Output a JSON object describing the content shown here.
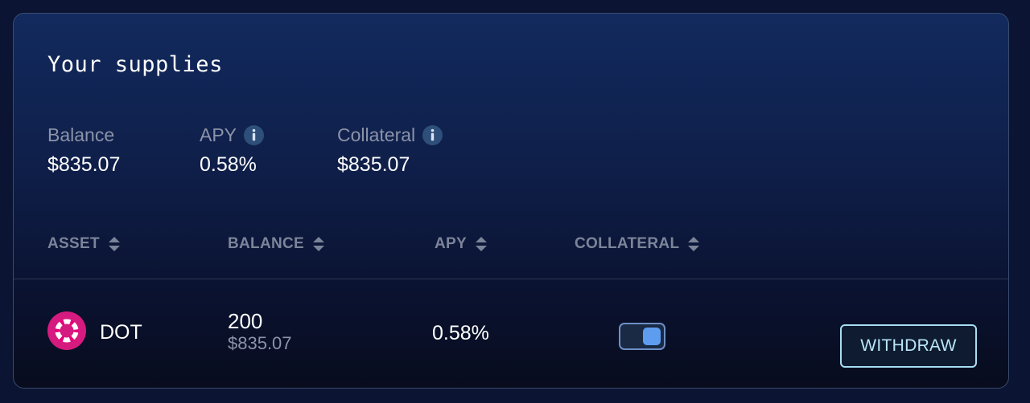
{
  "card": {
    "title": "Your supplies"
  },
  "stats": [
    {
      "label": "Balance",
      "value": "$835.07",
      "has_info": false
    },
    {
      "label": "APY",
      "value": "0.58%",
      "has_info": true
    },
    {
      "label": "Collateral",
      "value": "$835.07",
      "has_info": true
    }
  ],
  "table": {
    "headers": [
      "ASSET",
      "BALANCE",
      "APY",
      "COLLATERAL"
    ],
    "rows": [
      {
        "asset": "DOT",
        "asset_icon": "polkadot-logo-icon",
        "balance": "200",
        "balance_usd": "$835.07",
        "apy": "0.58%",
        "collateral_enabled": true,
        "action_label": "WITHDRAW"
      }
    ]
  },
  "colors": {
    "accent_toggle": "#5e9cf0",
    "withdraw_border": "#a7ddf2",
    "polkadot_brand": "#e6007a",
    "muted_text": "#8c93a8"
  }
}
